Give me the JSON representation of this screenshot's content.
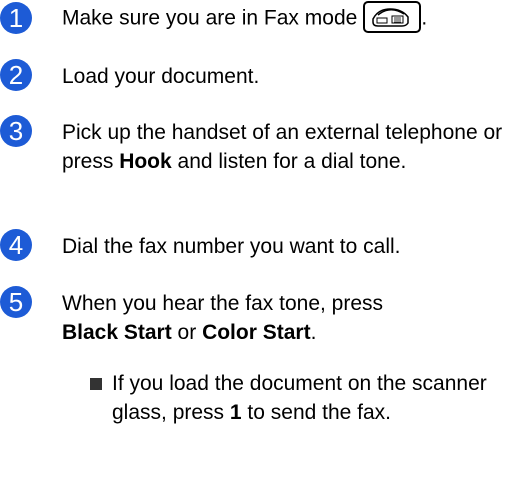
{
  "colors": {
    "step_number_bg": "#1d5bd6",
    "text": "#000000"
  },
  "steps": [
    {
      "number": "1",
      "text": "Make sure you are in Fax mode",
      "icon": "fax-mode-icon",
      "trailing": "."
    },
    {
      "number": "2",
      "text": "Load your document."
    },
    {
      "number": "3",
      "text_before": "Pick up the handset of an external telephone or press ",
      "bold": "Hook",
      "text_after": " and listen for a dial tone."
    },
    {
      "number": "4",
      "text": "Dial the fax number you want to call."
    },
    {
      "number": "5",
      "text_before": "When you hear the fax tone, press",
      "bold_1": "Black Start",
      "text_mid": " or ",
      "bold_2": "Color Start",
      "trailing": "."
    }
  ],
  "bullet": {
    "text_before": "If you load the document on the scanner glass, press ",
    "bold": "1",
    "text_after": " to send the fax."
  }
}
